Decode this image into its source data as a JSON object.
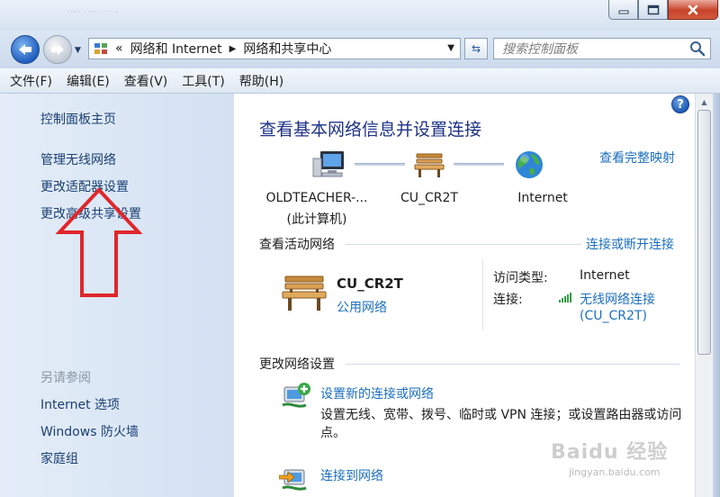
{
  "window": {
    "title": "",
    "ghost_title": "···· ····· ·· ·"
  },
  "address_bar": {
    "overflow_glyph": "«",
    "crumbs": [
      "网络和 Internet",
      "网络和共享中心"
    ],
    "separator": "▶",
    "dropdown_glyph": "▼",
    "refresh_glyph": "⇆"
  },
  "search": {
    "placeholder": "搜索控制面板"
  },
  "menu": [
    "文件(F)",
    "编辑(E)",
    "查看(V)",
    "工具(T)",
    "帮助(H)"
  ],
  "sidebar": {
    "items": [
      "控制面板主页",
      "管理无线网络",
      "更改适配器设置",
      "更改高级共享设置"
    ],
    "see_also_title": "另请参阅",
    "see_also": [
      "Internet 选项",
      "Windows 防火墙",
      "家庭组"
    ]
  },
  "main": {
    "heading": "查看基本网络信息并设置连接",
    "full_map_link": "查看完整映射",
    "help_glyph": "?",
    "map_nodes": [
      {
        "label": "OLDTEACHER-...",
        "sublabel": "(此计算机)",
        "icon": "computer-icon"
      },
      {
        "label": "CU_CR2T",
        "icon": "bench-icon"
      },
      {
        "label": "Internet",
        "icon": "globe-icon"
      }
    ],
    "active_networks": {
      "title": "查看活动网络",
      "action_link": "连接或断开连接",
      "network_name": "CU_CR2T",
      "network_type": "公用网络",
      "access_type_label": "访问类型:",
      "access_type_value": "Internet",
      "connection_label": "连接:",
      "connection_value": "无线网络连接",
      "connection_ssid": "(CU_CR2T)"
    },
    "change_settings": {
      "title": "更改网络设置",
      "tasks": [
        {
          "label": "设置新的连接或网络",
          "description": "设置无线、宽带、拨号、临时或 VPN 连接；或设置路由器或访问点。"
        },
        {
          "label": "连接到网络"
        }
      ]
    }
  },
  "watermark": {
    "text": "Baidu 经验",
    "url": "jingyan.baidu.com"
  },
  "colors": {
    "link": "#1d6fbe",
    "heading": "#1e3287",
    "annotation_arrow": "#e0262a"
  }
}
